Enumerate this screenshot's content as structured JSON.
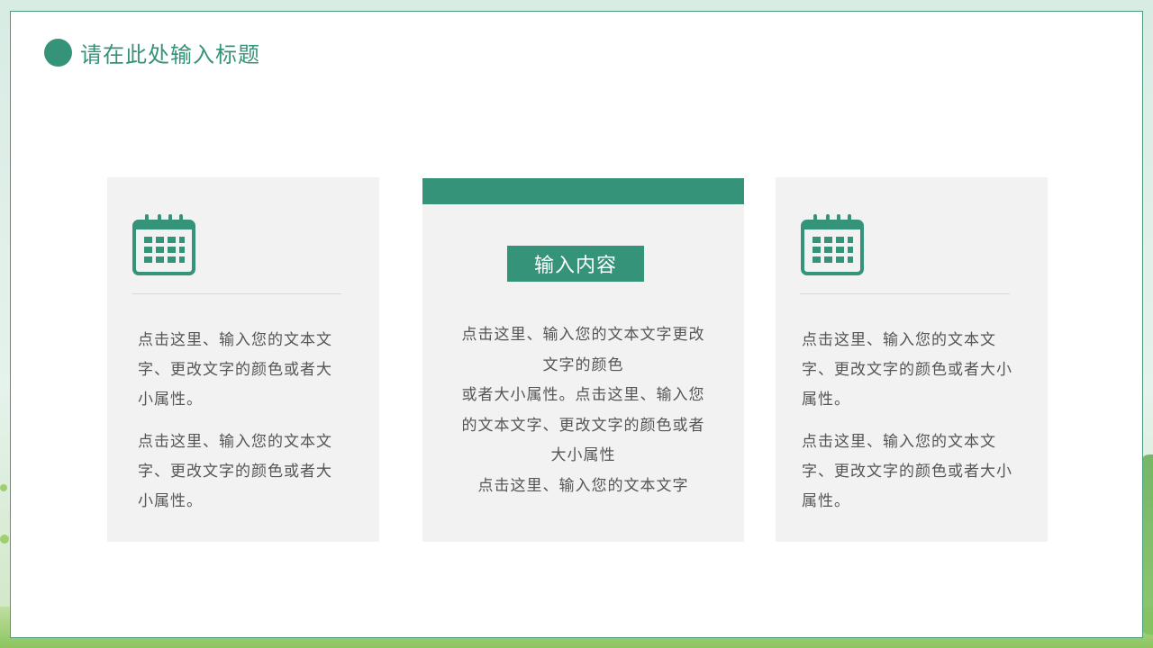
{
  "slide": {
    "title": "请在此处输入标题"
  },
  "cards": {
    "left": {
      "icon": "calendar-icon",
      "paragraph1": "点击这里、输入您的文本文字、更改文字的颜色或者大小属性。",
      "paragraph2": "点击这里、输入您的文本文字、更改文字的颜色或者大小属性。"
    },
    "middle": {
      "label": "输入内容",
      "lines": [
        "点击这里、输入您的文本文字更改文字的颜色",
        "或者大小属性。点击这里、输入您的文本文字、更改文字的颜色或者大小属性",
        "点击这里、输入您的文本文字"
      ]
    },
    "right": {
      "icon": "calendar-icon",
      "paragraph1": "点击这里、输入您的文本文字、更改文字的颜色或者大小属性。",
      "paragraph2": "点击这里、输入您的文本文字、更改文字的颜色或者大小属性。"
    }
  },
  "colors": {
    "accent": "#35937a",
    "card_bg": "#f2f2f2",
    "text": "#555555"
  }
}
